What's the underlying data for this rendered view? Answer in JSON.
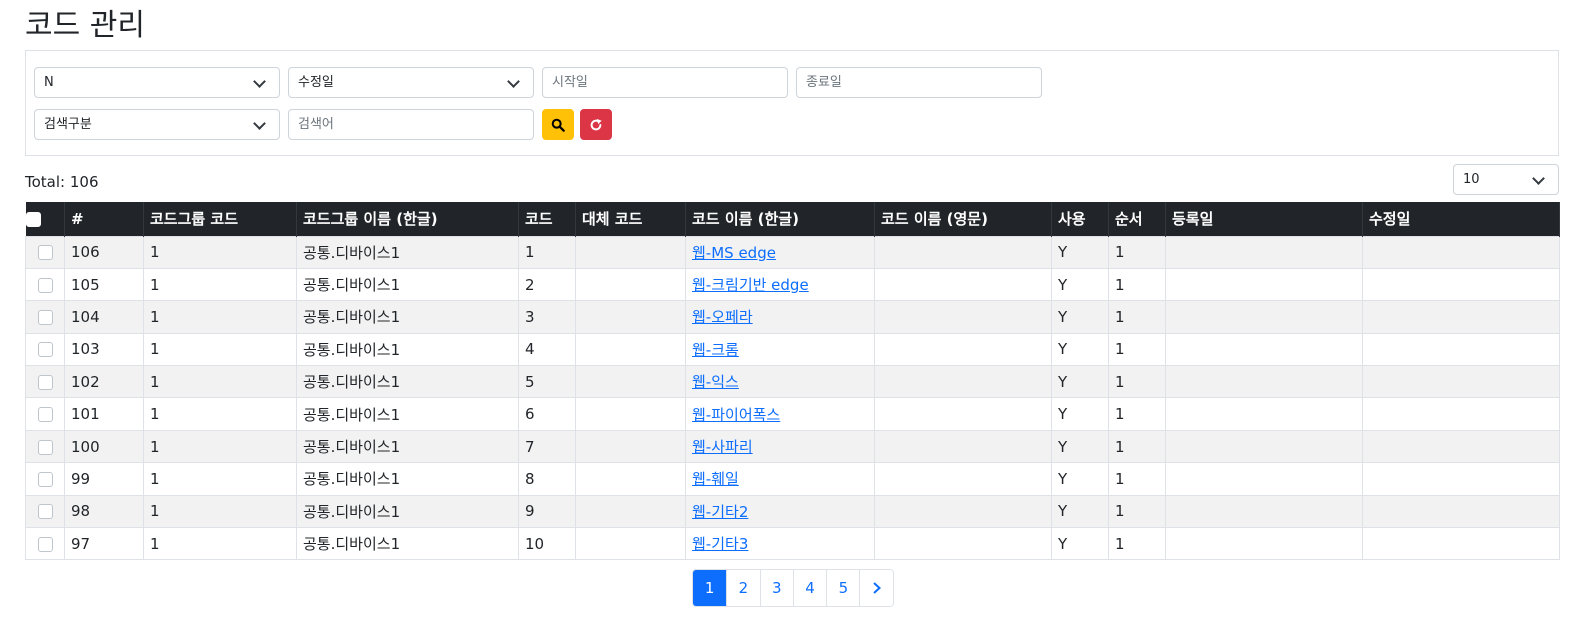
{
  "page": {
    "title": "코드 관리"
  },
  "filters": {
    "use_select": "N",
    "date_type_select": "수정일",
    "start_date_placeholder": "시작일",
    "end_date_placeholder": "종료일",
    "search_type_select": "검색구분",
    "keyword_placeholder": "검색어"
  },
  "summary": {
    "total_label": "Total: 106",
    "page_size": "10"
  },
  "table": {
    "headers": [
      "#",
      "코드그룹 코드",
      "코드그룹 이름 (한글)",
      "코드",
      "대체 코드",
      "코드 이름 (한글)",
      "코드 이름 (영문)",
      "사용",
      "순서",
      "등록일",
      "수정일"
    ],
    "rows": [
      {
        "no": "106",
        "group_code": "1",
        "group_name": "공통.디바이스1",
        "code": "1",
        "alt_code": "",
        "name_ko": "웹-MS edge",
        "name_en": "",
        "use": "Y",
        "order": "1",
        "created": "",
        "updated": ""
      },
      {
        "no": "105",
        "group_code": "1",
        "group_name": "공통.디바이스1",
        "code": "2",
        "alt_code": "",
        "name_ko": "웹-크림기반 edge",
        "name_en": "",
        "use": "Y",
        "order": "1",
        "created": "",
        "updated": ""
      },
      {
        "no": "104",
        "group_code": "1",
        "group_name": "공통.디바이스1",
        "code": "3",
        "alt_code": "",
        "name_ko": "웹-오페라",
        "name_en": "",
        "use": "Y",
        "order": "1",
        "created": "",
        "updated": ""
      },
      {
        "no": "103",
        "group_code": "1",
        "group_name": "공통.디바이스1",
        "code": "4",
        "alt_code": "",
        "name_ko": "웹-크롬",
        "name_en": "",
        "use": "Y",
        "order": "1",
        "created": "",
        "updated": ""
      },
      {
        "no": "102",
        "group_code": "1",
        "group_name": "공통.디바이스1",
        "code": "5",
        "alt_code": "",
        "name_ko": "웹-익스",
        "name_en": "",
        "use": "Y",
        "order": "1",
        "created": "",
        "updated": ""
      },
      {
        "no": "101",
        "group_code": "1",
        "group_name": "공통.디바이스1",
        "code": "6",
        "alt_code": "",
        "name_ko": "웹-파이어폭스",
        "name_en": "",
        "use": "Y",
        "order": "1",
        "created": "",
        "updated": ""
      },
      {
        "no": "100",
        "group_code": "1",
        "group_name": "공통.디바이스1",
        "code": "7",
        "alt_code": "",
        "name_ko": "웹-사파리",
        "name_en": "",
        "use": "Y",
        "order": "1",
        "created": "",
        "updated": ""
      },
      {
        "no": "99",
        "group_code": "1",
        "group_name": "공통.디바이스1",
        "code": "8",
        "alt_code": "",
        "name_ko": "웹-훼일",
        "name_en": "",
        "use": "Y",
        "order": "1",
        "created": "",
        "updated": ""
      },
      {
        "no": "98",
        "group_code": "1",
        "group_name": "공통.디바이스1",
        "code": "9",
        "alt_code": "",
        "name_ko": "웹-기타2",
        "name_en": "",
        "use": "Y",
        "order": "1",
        "created": "",
        "updated": ""
      },
      {
        "no": "97",
        "group_code": "1",
        "group_name": "공통.디바이스1",
        "code": "10",
        "alt_code": "",
        "name_ko": "웹-기타3",
        "name_en": "",
        "use": "Y",
        "order": "1",
        "created": "",
        "updated": ""
      }
    ]
  },
  "pagination": {
    "pages": [
      "1",
      "2",
      "3",
      "4",
      "5"
    ],
    "active": "1",
    "next_icon": "chevron-right-icon"
  },
  "icons": {
    "search": "search-icon",
    "reset": "refresh-icon"
  },
  "colors": {
    "header_bg": "#212529",
    "link": "#0d6efd",
    "search_btn": "#ffc107",
    "reset_btn": "#dc3545",
    "active_page": "#0d6efd"
  }
}
